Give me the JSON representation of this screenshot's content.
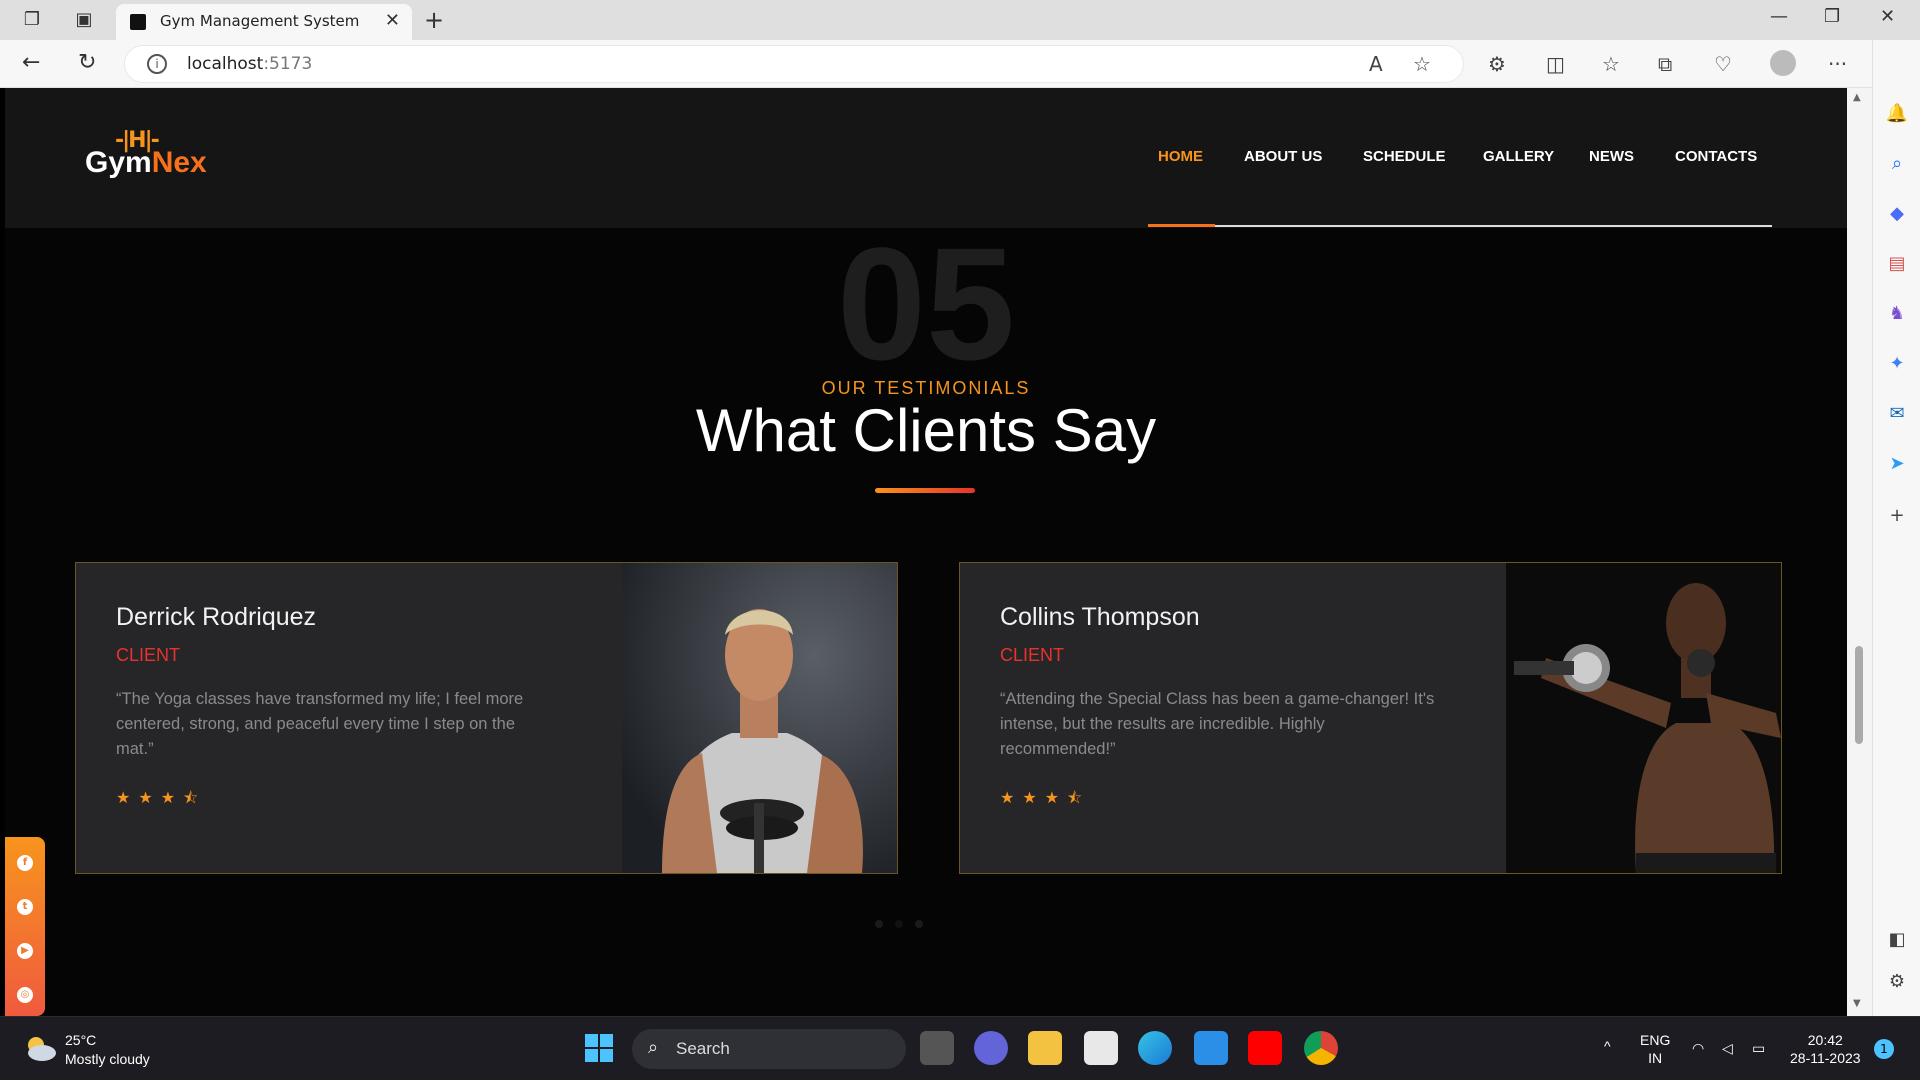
{
  "browser": {
    "tab_title": "Gym Management System",
    "url_host": "localhost",
    "url_port": ":5173"
  },
  "site": {
    "logo_gym": "Gym",
    "logo_nex": "Nex",
    "nav": [
      "HOME",
      "ABOUT US",
      "SCHEDULE",
      "GALLERY",
      "NEWS",
      "CONTACTS"
    ],
    "active_nav": "HOME"
  },
  "section": {
    "number": "05",
    "subtitle": "OUR TESTIMONIALS",
    "title": "What Clients Say"
  },
  "testimonials": [
    {
      "name": "Derrick Rodriquez",
      "role": "CLIENT",
      "quote": "“The Yoga classes have transformed my life; I feel more centered, strong, and peaceful every time I step on the mat.”",
      "rating": 3.5
    },
    {
      "name": "Collins Thompson",
      "role": "CLIENT",
      "quote": "“Attending the Special Class has been a game-changer! It's intense, but the results are incredible. Highly recommended!”",
      "rating": 3.5
    }
  ],
  "taskbar": {
    "temp": "25°C",
    "weather": "Mostly cloudy",
    "search": "Search",
    "lang1": "ENG",
    "lang2": "IN",
    "time": "20:42",
    "date": "28-11-2023",
    "notifications": "1"
  },
  "colors": {
    "accent": "#f7941d",
    "accent_red": "#e8332b",
    "page_bg": "#050505",
    "card_bg": "#262628"
  }
}
